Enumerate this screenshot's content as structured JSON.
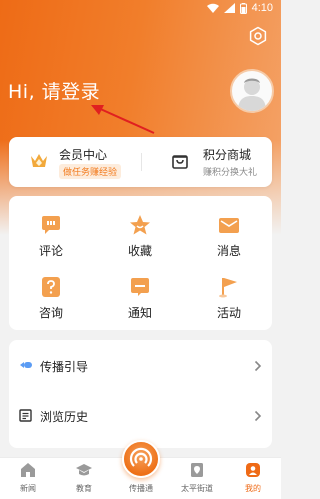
{
  "status_bar": {
    "time": "4:10"
  },
  "header": {
    "greeting": "Hi, 请登录"
  },
  "member_card": {
    "member_center": {
      "title": "会员中心",
      "subtitle": "做任务赚经验"
    },
    "points_mall": {
      "title": "积分商城",
      "subtitle": "赚积分换大礼"
    }
  },
  "grid": {
    "items": [
      {
        "label": "评论",
        "icon": "comment-icon"
      },
      {
        "label": "收藏",
        "icon": "star-icon"
      },
      {
        "label": "消息",
        "icon": "mail-icon"
      },
      {
        "label": "咨询",
        "icon": "question-icon"
      },
      {
        "label": "通知",
        "icon": "notice-icon"
      },
      {
        "label": "活动",
        "icon": "flag-icon"
      }
    ]
  },
  "list": {
    "items": [
      {
        "label": "传播引导",
        "icon": "guide-icon"
      },
      {
        "label": "浏览历史",
        "icon": "history-icon"
      }
    ]
  },
  "bottom_nav": {
    "items": [
      {
        "label": "新闻"
      },
      {
        "label": "教育"
      },
      {
        "label": "传播通"
      },
      {
        "label": "太平街道"
      },
      {
        "label": "我的"
      }
    ]
  },
  "colors": {
    "accent": "#ef6a16",
    "accent_light": "#f4a46a",
    "annotation_arrow": "#e02020"
  }
}
